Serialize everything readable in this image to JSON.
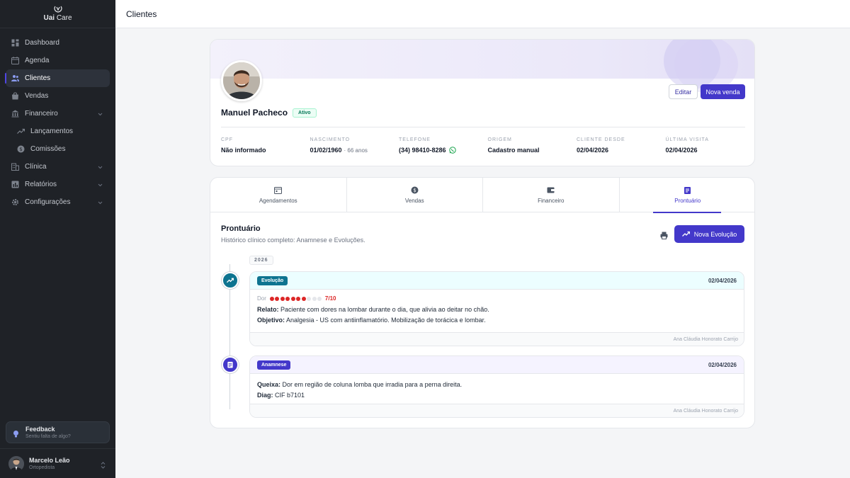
{
  "app": {
    "logo_part1": "Uai",
    "logo_part2": "Care"
  },
  "sidebar": {
    "items": [
      {
        "label": "Dashboard",
        "icon": "dashboard-icon"
      },
      {
        "label": "Agenda",
        "icon": "calendar-icon"
      },
      {
        "label": "Clientes",
        "icon": "users-icon",
        "active": true
      },
      {
        "label": "Vendas",
        "icon": "shopping-bag-icon"
      },
      {
        "label": "Financeiro",
        "icon": "bank-icon",
        "expandable": true
      },
      {
        "label": "Lançamentos",
        "icon": "trending-up-icon",
        "sub": true
      },
      {
        "label": "Comissões",
        "icon": "dollar-circle-icon",
        "sub": true
      },
      {
        "label": "Clínica",
        "icon": "clinic-icon",
        "expandable": true
      },
      {
        "label": "Relatórios",
        "icon": "chart-icon",
        "expandable": true
      },
      {
        "label": "Configurações",
        "icon": "gear-icon",
        "expandable": true
      }
    ],
    "feedback": {
      "title": "Feedback",
      "subtitle": "Sentiu falta de algo?"
    },
    "user": {
      "name": "Marcelo Leão",
      "role": "Ortopedista"
    }
  },
  "header": {
    "title": "Clientes"
  },
  "profile": {
    "name": "Manuel Pacheco",
    "status": "Ativo",
    "edit_label": "Editar",
    "new_sale_label": "Nova venda",
    "fields": [
      {
        "label": "CPF",
        "value": "Não informado"
      },
      {
        "label": "NASCIMENTO",
        "value": "01/02/1960",
        "extra": "· 66 anos"
      },
      {
        "label": "TELEFONE",
        "value": "(34) 98410-8286"
      },
      {
        "label": "ORIGEM",
        "value": "Cadastro manual"
      },
      {
        "label": "CLIENTE DESDE",
        "value": "02/04/2026"
      },
      {
        "label": "ÚLTIMA VISITA",
        "value": "02/04/2026"
      }
    ]
  },
  "tabs": [
    {
      "label": "Agendamentos",
      "icon": "calendar-icon"
    },
    {
      "label": "Vendas",
      "icon": "dollar-circle-icon"
    },
    {
      "label": "Financeiro",
      "icon": "wallet-icon"
    },
    {
      "label": "Prontuário",
      "icon": "clipboard-icon",
      "active": true
    }
  ],
  "record": {
    "title": "Prontuário",
    "subtitle": "Histórico clínico completo: Anamnese e Evoluções.",
    "new_evolution_label": "Nova Evolução",
    "year": "2026",
    "entries": [
      {
        "type": "Evolução",
        "date": "02/04/2026",
        "pain_label": "Dor",
        "pain_value": "7/10",
        "pain_level": 7,
        "pain_max": 10,
        "lines": [
          {
            "key": "Relato:",
            "text": " Paciente com dores na lombar durante o dia, que alivia ao deitar no chão."
          },
          {
            "key": "Objetivo:",
            "text": " Analgesia - US com antiinflamatório. Mobilização de torácica e lombar."
          }
        ],
        "author": "Ana Cláudia Honorato Carrijo",
        "color": "#0e7490"
      },
      {
        "type": "Anamnese",
        "date": "02/04/2026",
        "lines": [
          {
            "key": "Queixa:",
            "text": " Dor em região de coluna lomba que irradia para a perna direita."
          },
          {
            "key": "Diag:",
            "text": " CIF b7101"
          }
        ],
        "author": "Ana Cláudia Honorato Carrijo",
        "color": "#4338ca"
      }
    ]
  },
  "colors": {
    "accent": "#4338ca",
    "sidebar_bg": "#1f2227",
    "teal": "#0e7490",
    "pain": "#dc2626"
  }
}
